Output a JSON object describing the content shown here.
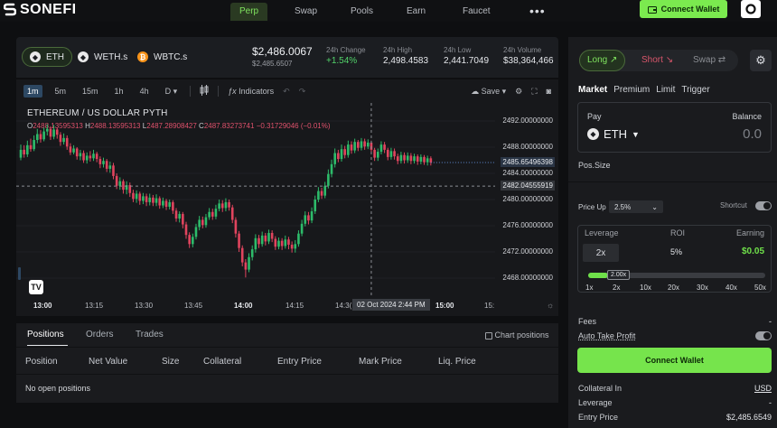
{
  "brand": {
    "name": "SONEFI"
  },
  "nav": {
    "items": [
      {
        "label": "Perp",
        "active": true
      },
      {
        "label": "Swap",
        "active": false
      },
      {
        "label": "Pools",
        "active": false
      },
      {
        "label": "Earn",
        "active": false
      },
      {
        "label": "Faucet",
        "active": false
      }
    ],
    "more_icon": "more-dots-icon",
    "connect_wallet": "Connect Wallet"
  },
  "market": {
    "assets": [
      {
        "label": "ETH",
        "icon": "eth-icon",
        "active": true
      },
      {
        "label": "WETH.s",
        "icon": "eth-icon",
        "active": false
      },
      {
        "label": "WBTC.s",
        "icon": "btc-icon",
        "active": false
      }
    ],
    "price": "$2,486.0067",
    "price_sub": "$2,485.6507",
    "stats": [
      {
        "label": "24h Change",
        "value": "+1.54%",
        "positive": true
      },
      {
        "label": "24h High",
        "value": "2,498.4583"
      },
      {
        "label": "24h Low",
        "value": "2,441.7049"
      },
      {
        "label": "24h Volume",
        "value": "$38,364,466"
      }
    ]
  },
  "chart": {
    "timeframes": [
      "1m",
      "5m",
      "15m",
      "1h",
      "4h",
      "D"
    ],
    "active_timeframe": "1m",
    "indicators_label": "Indicators",
    "save_label": "Save",
    "title": "ETHEREUM / US DOLLAR  PYTH",
    "ohlc": {
      "o_key": "O",
      "o": "2488.13595313",
      "h_key": "H",
      "h": "2488.13595313",
      "l_key": "L",
      "l": "2487.28908427",
      "c_key": "C",
      "c": "2487.83273741",
      "change": "−0.31729046 (−0.01%)"
    },
    "price_levels": [
      "2492.00000000",
      "2488.00000000",
      "2484.00000000",
      "2480.00000000",
      "2476.00000000",
      "2472.00000000",
      "2468.00000000"
    ],
    "last_price_tag": "2485.65496398",
    "crosshair_price_tag": "2482.04555919",
    "time_labels": [
      {
        "label": "13:00",
        "bold": true
      },
      {
        "label": "13:15",
        "bold": false
      },
      {
        "label": "13:30",
        "bold": false
      },
      {
        "label": "13:45",
        "bold": false
      },
      {
        "label": "14:00",
        "bold": true
      },
      {
        "label": "14:15",
        "bold": false
      },
      {
        "label": "14:3(",
        "bold": false
      },
      {
        "label": "15:00",
        "bold": true
      },
      {
        "label": "15:",
        "bold": false
      }
    ],
    "crosshair_date": "02 Oct 2024   2:44 PM"
  },
  "chart_data": {
    "type": "candlestick",
    "title": "ETHEREUM / US DOLLAR  PYTH",
    "ylim": [
      2466,
      2494
    ],
    "xlim": [
      "12:58",
      "15:20"
    ],
    "candles": [
      {
        "t": "12:58",
        "o": 2486.4,
        "c": 2487.6,
        "h": 2488.4,
        "l": 2486.0
      },
      {
        "t": "12:59",
        "o": 2487.6,
        "c": 2486.9,
        "h": 2488.3,
        "l": 2486.4
      },
      {
        "t": "13:00",
        "o": 2486.9,
        "c": 2488.3,
        "h": 2489.0,
        "l": 2486.5
      },
      {
        "t": "13:01",
        "o": 2488.3,
        "c": 2487.7,
        "h": 2489.3,
        "l": 2487.3
      },
      {
        "t": "13:02",
        "o": 2487.7,
        "c": 2489.1,
        "h": 2489.8,
        "l": 2487.4
      },
      {
        "t": "13:03",
        "o": 2489.1,
        "c": 2490.0,
        "h": 2490.8,
        "l": 2488.6
      },
      {
        "t": "13:04",
        "o": 2490.0,
        "c": 2489.2,
        "h": 2490.6,
        "l": 2488.7
      },
      {
        "t": "13:05",
        "o": 2489.2,
        "c": 2490.4,
        "h": 2491.0,
        "l": 2488.9
      },
      {
        "t": "13:06",
        "o": 2490.4,
        "c": 2490.8,
        "h": 2491.5,
        "l": 2489.8
      },
      {
        "t": "13:07",
        "o": 2490.8,
        "c": 2489.6,
        "h": 2491.2,
        "l": 2489.1
      },
      {
        "t": "13:08",
        "o": 2489.6,
        "c": 2490.7,
        "h": 2491.4,
        "l": 2489.2
      },
      {
        "t": "13:09",
        "o": 2490.7,
        "c": 2489.9,
        "h": 2491.0,
        "l": 2489.3
      },
      {
        "t": "13:10",
        "o": 2489.9,
        "c": 2488.8,
        "h": 2490.3,
        "l": 2488.2
      },
      {
        "t": "13:11",
        "o": 2488.8,
        "c": 2489.4,
        "h": 2490.1,
        "l": 2488.4
      },
      {
        "t": "13:12",
        "o": 2489.4,
        "c": 2488.1,
        "h": 2489.8,
        "l": 2487.6
      },
      {
        "t": "13:13",
        "o": 2488.1,
        "c": 2487.2,
        "h": 2488.6,
        "l": 2486.8
      },
      {
        "t": "13:14",
        "o": 2487.2,
        "c": 2487.8,
        "h": 2488.3,
        "l": 2486.9
      },
      {
        "t": "13:15",
        "o": 2487.8,
        "c": 2486.6,
        "h": 2488.0,
        "l": 2486.1
      },
      {
        "t": "13:16",
        "o": 2486.6,
        "c": 2487.1,
        "h": 2487.6,
        "l": 2486.0
      },
      {
        "t": "13:17",
        "o": 2487.1,
        "c": 2486.0,
        "h": 2487.5,
        "l": 2485.6
      },
      {
        "t": "13:18",
        "o": 2486.0,
        "c": 2486.7,
        "h": 2487.2,
        "l": 2485.5
      },
      {
        "t": "13:19",
        "o": 2486.7,
        "c": 2486.3,
        "h": 2487.4,
        "l": 2485.8
      },
      {
        "t": "13:20",
        "o": 2486.3,
        "c": 2487.0,
        "h": 2487.6,
        "l": 2485.9
      },
      {
        "t": "13:21",
        "o": 2487.0,
        "c": 2486.2,
        "h": 2487.3,
        "l": 2485.7
      },
      {
        "t": "13:22",
        "o": 2486.2,
        "c": 2485.4,
        "h": 2486.6,
        "l": 2484.8
      },
      {
        "t": "13:23",
        "o": 2485.4,
        "c": 2485.9,
        "h": 2486.4,
        "l": 2484.9
      },
      {
        "t": "13:24",
        "o": 2485.9,
        "c": 2484.7,
        "h": 2486.2,
        "l": 2484.2
      },
      {
        "t": "13:25",
        "o": 2484.7,
        "c": 2485.2,
        "h": 2485.8,
        "l": 2484.1
      },
      {
        "t": "13:26",
        "o": 2485.2,
        "c": 2483.6,
        "h": 2485.6,
        "l": 2483.1
      },
      {
        "t": "13:27",
        "o": 2483.6,
        "c": 2482.1,
        "h": 2484.0,
        "l": 2481.6
      },
      {
        "t": "13:28",
        "o": 2482.1,
        "c": 2482.8,
        "h": 2483.4,
        "l": 2481.5
      },
      {
        "t": "13:29",
        "o": 2482.8,
        "c": 2481.5,
        "h": 2483.1,
        "l": 2480.9
      },
      {
        "t": "13:30",
        "o": 2481.5,
        "c": 2482.2,
        "h": 2482.8,
        "l": 2480.8
      },
      {
        "t": "13:31",
        "o": 2482.2,
        "c": 2481.0,
        "h": 2482.6,
        "l": 2480.4
      },
      {
        "t": "13:32",
        "o": 2481.0,
        "c": 2480.1,
        "h": 2481.5,
        "l": 2479.6
      },
      {
        "t": "13:33",
        "o": 2480.1,
        "c": 2480.9,
        "h": 2481.4,
        "l": 2479.5
      },
      {
        "t": "13:34",
        "o": 2480.9,
        "c": 2479.8,
        "h": 2481.2,
        "l": 2479.2
      },
      {
        "t": "13:35",
        "o": 2479.8,
        "c": 2480.5,
        "h": 2481.0,
        "l": 2479.3
      },
      {
        "t": "13:36",
        "o": 2480.5,
        "c": 2479.6,
        "h": 2480.9,
        "l": 2479.0
      },
      {
        "t": "13:37",
        "o": 2479.6,
        "c": 2480.3,
        "h": 2480.9,
        "l": 2479.1
      },
      {
        "t": "13:38",
        "o": 2480.3,
        "c": 2479.5,
        "h": 2480.7,
        "l": 2479.0
      },
      {
        "t": "13:39",
        "o": 2479.5,
        "c": 2480.2,
        "h": 2480.8,
        "l": 2479.0
      },
      {
        "t": "13:40",
        "o": 2480.2,
        "c": 2479.1,
        "h": 2480.5,
        "l": 2478.6
      },
      {
        "t": "13:41",
        "o": 2479.1,
        "c": 2479.8,
        "h": 2480.3,
        "l": 2478.7
      },
      {
        "t": "13:42",
        "o": 2479.8,
        "c": 2478.9,
        "h": 2480.1,
        "l": 2478.4
      },
      {
        "t": "13:43",
        "o": 2478.9,
        "c": 2479.6,
        "h": 2480.0,
        "l": 2478.5
      },
      {
        "t": "13:44",
        "o": 2479.6,
        "c": 2478.3,
        "h": 2479.9,
        "l": 2477.8
      },
      {
        "t": "13:45",
        "o": 2478.3,
        "c": 2477.1,
        "h": 2478.7,
        "l": 2476.6
      },
      {
        "t": "13:46",
        "o": 2477.1,
        "c": 2477.8,
        "h": 2478.2,
        "l": 2476.5
      },
      {
        "t": "13:47",
        "o": 2477.8,
        "c": 2476.2,
        "h": 2478.1,
        "l": 2475.6
      },
      {
        "t": "13:48",
        "o": 2476.2,
        "c": 2474.6,
        "h": 2476.6,
        "l": 2474.0
      },
      {
        "t": "13:49",
        "o": 2474.6,
        "c": 2473.2,
        "h": 2475.0,
        "l": 2472.6
      },
      {
        "t": "13:50",
        "o": 2473.2,
        "c": 2474.3,
        "h": 2474.8,
        "l": 2472.7
      },
      {
        "t": "13:51",
        "o": 2474.3,
        "c": 2475.8,
        "h": 2476.3,
        "l": 2473.9
      },
      {
        "t": "13:52",
        "o": 2475.8,
        "c": 2476.9,
        "h": 2477.5,
        "l": 2475.3
      },
      {
        "t": "13:53",
        "o": 2476.9,
        "c": 2476.1,
        "h": 2477.4,
        "l": 2475.6
      },
      {
        "t": "13:54",
        "o": 2476.1,
        "c": 2477.3,
        "h": 2477.8,
        "l": 2475.7
      },
      {
        "t": "13:55",
        "o": 2477.3,
        "c": 2478.1,
        "h": 2478.7,
        "l": 2476.9
      },
      {
        "t": "13:56",
        "o": 2478.1,
        "c": 2477.4,
        "h": 2478.6,
        "l": 2476.9
      },
      {
        "t": "13:57",
        "o": 2477.4,
        "c": 2478.6,
        "h": 2479.2,
        "l": 2477.0
      },
      {
        "t": "13:58",
        "o": 2478.6,
        "c": 2479.4,
        "h": 2480.0,
        "l": 2478.2
      },
      {
        "t": "13:59",
        "o": 2479.4,
        "c": 2478.7,
        "h": 2479.9,
        "l": 2478.1
      },
      {
        "t": "14:00",
        "o": 2478.7,
        "c": 2479.6,
        "h": 2480.2,
        "l": 2478.2
      },
      {
        "t": "14:01",
        "o": 2479.6,
        "c": 2478.8,
        "h": 2480.0,
        "l": 2478.3
      },
      {
        "t": "14:02",
        "o": 2478.8,
        "c": 2476.9,
        "h": 2479.2,
        "l": 2476.4
      },
      {
        "t": "14:03",
        "o": 2476.9,
        "c": 2474.8,
        "h": 2477.3,
        "l": 2474.2
      },
      {
        "t": "14:04",
        "o": 2474.8,
        "c": 2472.6,
        "h": 2475.2,
        "l": 2472.0
      },
      {
        "t": "14:05",
        "o": 2472.6,
        "c": 2470.4,
        "h": 2473.0,
        "l": 2469.8
      },
      {
        "t": "14:06",
        "o": 2470.4,
        "c": 2469.3,
        "h": 2470.9,
        "l": 2468.1
      },
      {
        "t": "14:07",
        "o": 2469.3,
        "c": 2471.2,
        "h": 2471.8,
        "l": 2468.9
      },
      {
        "t": "14:08",
        "o": 2471.2,
        "c": 2472.4,
        "h": 2473.0,
        "l": 2470.7
      },
      {
        "t": "14:09",
        "o": 2472.4,
        "c": 2474.1,
        "h": 2474.7,
        "l": 2471.9
      },
      {
        "t": "14:10",
        "o": 2474.1,
        "c": 2473.2,
        "h": 2474.6,
        "l": 2472.6
      },
      {
        "t": "14:11",
        "o": 2473.2,
        "c": 2474.5,
        "h": 2475.1,
        "l": 2472.8
      },
      {
        "t": "14:12",
        "o": 2474.5,
        "c": 2473.6,
        "h": 2474.9,
        "l": 2473.0
      },
      {
        "t": "14:13",
        "o": 2473.6,
        "c": 2474.9,
        "h": 2475.4,
        "l": 2473.2
      },
      {
        "t": "14:14",
        "o": 2474.9,
        "c": 2474.0,
        "h": 2475.3,
        "l": 2473.5
      },
      {
        "t": "14:15",
        "o": 2474.0,
        "c": 2472.8,
        "h": 2474.4,
        "l": 2472.3
      },
      {
        "t": "14:16",
        "o": 2472.8,
        "c": 2473.7,
        "h": 2474.2,
        "l": 2472.4
      },
      {
        "t": "14:17",
        "o": 2473.7,
        "c": 2472.9,
        "h": 2474.1,
        "l": 2472.3
      },
      {
        "t": "14:18",
        "o": 2472.9,
        "c": 2473.9,
        "h": 2474.5,
        "l": 2472.5
      },
      {
        "t": "14:19",
        "o": 2473.9,
        "c": 2473.1,
        "h": 2474.3,
        "l": 2472.4
      },
      {
        "t": "14:20",
        "o": 2473.1,
        "c": 2472.5,
        "h": 2473.6,
        "l": 2471.9
      },
      {
        "t": "14:21",
        "o": 2472.5,
        "c": 2473.2,
        "h": 2473.8,
        "l": 2471.9
      },
      {
        "t": "14:22",
        "o": 2473.2,
        "c": 2474.8,
        "h": 2475.3,
        "l": 2472.8
      },
      {
        "t": "14:23",
        "o": 2474.8,
        "c": 2476.3,
        "h": 2476.9,
        "l": 2474.4
      },
      {
        "t": "14:24",
        "o": 2476.3,
        "c": 2477.6,
        "h": 2478.2,
        "l": 2475.9
      },
      {
        "t": "14:25",
        "o": 2477.6,
        "c": 2476.8,
        "h": 2478.1,
        "l": 2476.2
      },
      {
        "t": "14:26",
        "o": 2476.8,
        "c": 2478.2,
        "h": 2478.8,
        "l": 2476.4
      },
      {
        "t": "14:27",
        "o": 2478.2,
        "c": 2480.0,
        "h": 2480.6,
        "l": 2477.8
      },
      {
        "t": "14:28",
        "o": 2480.0,
        "c": 2481.3,
        "h": 2481.9,
        "l": 2479.6
      },
      {
        "t": "14:29",
        "o": 2481.3,
        "c": 2480.6,
        "h": 2481.8,
        "l": 2480.1
      },
      {
        "t": "14:30",
        "o": 2480.6,
        "c": 2482.1,
        "h": 2482.7,
        "l": 2480.2
      },
      {
        "t": "14:31",
        "o": 2482.1,
        "c": 2483.9,
        "h": 2484.6,
        "l": 2481.7
      },
      {
        "t": "14:32",
        "o": 2483.9,
        "c": 2485.4,
        "h": 2486.1,
        "l": 2483.4
      },
      {
        "t": "14:33",
        "o": 2485.4,
        "c": 2487.1,
        "h": 2487.8,
        "l": 2484.9
      },
      {
        "t": "14:34",
        "o": 2487.1,
        "c": 2486.2,
        "h": 2487.6,
        "l": 2485.7
      },
      {
        "t": "14:35",
        "o": 2486.2,
        "c": 2487.7,
        "h": 2488.4,
        "l": 2485.8
      },
      {
        "t": "14:36",
        "o": 2487.7,
        "c": 2486.8,
        "h": 2488.2,
        "l": 2486.3
      },
      {
        "t": "14:37",
        "o": 2486.8,
        "c": 2488.4,
        "h": 2489.0,
        "l": 2486.4
      },
      {
        "t": "14:38",
        "o": 2488.4,
        "c": 2487.5,
        "h": 2488.9,
        "l": 2487.0
      },
      {
        "t": "14:39",
        "o": 2487.5,
        "c": 2488.8,
        "h": 2489.3,
        "l": 2487.1
      },
      {
        "t": "14:40",
        "o": 2488.8,
        "c": 2487.9,
        "h": 2489.1,
        "l": 2487.4
      },
      {
        "t": "14:41",
        "o": 2487.9,
        "c": 2488.9,
        "h": 2489.4,
        "l": 2487.5
      },
      {
        "t": "14:42",
        "o": 2488.9,
        "c": 2488.1,
        "h": 2489.3,
        "l": 2487.6
      },
      {
        "t": "14:43",
        "o": 2488.1,
        "c": 2488.7,
        "h": 2489.2,
        "l": 2487.7
      },
      {
        "t": "14:44",
        "o": 2488.7,
        "c": 2487.6,
        "h": 2489.0,
        "l": 2487.1
      },
      {
        "t": "14:45",
        "o": 2487.6,
        "c": 2486.4,
        "h": 2487.9,
        "l": 2485.9
      },
      {
        "t": "14:46",
        "o": 2486.4,
        "c": 2487.3,
        "h": 2487.8,
        "l": 2485.9
      },
      {
        "t": "14:47",
        "o": 2487.3,
        "c": 2488.4,
        "h": 2488.9,
        "l": 2486.9
      },
      {
        "t": "14:48",
        "o": 2488.4,
        "c": 2487.6,
        "h": 2488.8,
        "l": 2487.1
      },
      {
        "t": "14:49",
        "o": 2487.6,
        "c": 2486.5,
        "h": 2487.9,
        "l": 2486.0
      },
      {
        "t": "14:50",
        "o": 2486.5,
        "c": 2487.4,
        "h": 2487.9,
        "l": 2486.1
      },
      {
        "t": "14:51",
        "o": 2487.4,
        "c": 2486.6,
        "h": 2487.8,
        "l": 2486.1
      },
      {
        "t": "14:52",
        "o": 2486.6,
        "c": 2485.9,
        "h": 2487.0,
        "l": 2485.4
      },
      {
        "t": "14:53",
        "o": 2485.9,
        "c": 2486.8,
        "h": 2487.3,
        "l": 2485.5
      },
      {
        "t": "14:54",
        "o": 2486.8,
        "c": 2486.0,
        "h": 2487.2,
        "l": 2485.5
      },
      {
        "t": "14:55",
        "o": 2486.0,
        "c": 2486.7,
        "h": 2487.2,
        "l": 2485.6
      },
      {
        "t": "14:56",
        "o": 2486.7,
        "c": 2485.9,
        "h": 2487.1,
        "l": 2485.4
      },
      {
        "t": "14:57",
        "o": 2485.9,
        "c": 2486.6,
        "h": 2487.0,
        "l": 2485.5
      },
      {
        "t": "14:58",
        "o": 2486.6,
        "c": 2485.8,
        "h": 2486.9,
        "l": 2485.3
      },
      {
        "t": "14:59",
        "o": 2485.8,
        "c": 2486.5,
        "h": 2486.9,
        "l": 2485.4
      },
      {
        "t": "15:00",
        "o": 2486.5,
        "c": 2485.7,
        "h": 2486.8,
        "l": 2485.3
      },
      {
        "t": "15:01",
        "o": 2485.7,
        "c": 2486.3,
        "h": 2486.7,
        "l": 2485.2
      },
      {
        "t": "15:02",
        "o": 2486.3,
        "c": 2485.65,
        "h": 2486.6,
        "l": 2485.2
      }
    ],
    "last_price": 2485.65496398,
    "crosshair_price": 2482.04555919
  },
  "positions": {
    "tabs": [
      "Positions",
      "Orders",
      "Trades"
    ],
    "active_tab": "Positions",
    "chart_positions_label": "Chart positions",
    "columns": [
      "Position",
      "Net Value",
      "Size",
      "Collateral",
      "Entry Price",
      "Mark Price",
      "Liq. Price"
    ],
    "empty_text": "No open positions"
  },
  "trade": {
    "sides": [
      {
        "label": "Long",
        "active": true
      },
      {
        "label": "Short",
        "active": false
      },
      {
        "label": "Swap",
        "active": false
      }
    ],
    "order_types": [
      "Market",
      "Premium",
      "Limit",
      "Trigger"
    ],
    "active_order_type": "Market",
    "pay_label": "Pay",
    "balance_label": "Balance",
    "pay_asset": "ETH",
    "pay_amount": "0.0",
    "pos_size_label": "Pos.Size",
    "price_up_label": "Price Up",
    "price_up_value": "2.5%",
    "shortcut_label": "Shortcut",
    "leverage_header": "Leverage",
    "roi_header": "ROI",
    "earning_header": "Earning",
    "leverage_value": "2x",
    "roi_value": "5%",
    "earning_value": "$0.05",
    "slider_value": "2.00x",
    "slider_fraction": 0.0204,
    "slider_ticks": [
      "1x",
      "2x",
      "10x",
      "20x",
      "30x",
      "40x",
      "50x"
    ],
    "fees_label": "Fees",
    "fees_value": "-",
    "auto_tp_label": "Auto Take Profit",
    "connect_wallet": "Connect Wallet",
    "summary": [
      {
        "label": "Collateral In",
        "value": "USD"
      },
      {
        "label": "Leverage",
        "value": "-"
      },
      {
        "label": "Entry Price",
        "value": "$2,485.6549"
      }
    ]
  }
}
